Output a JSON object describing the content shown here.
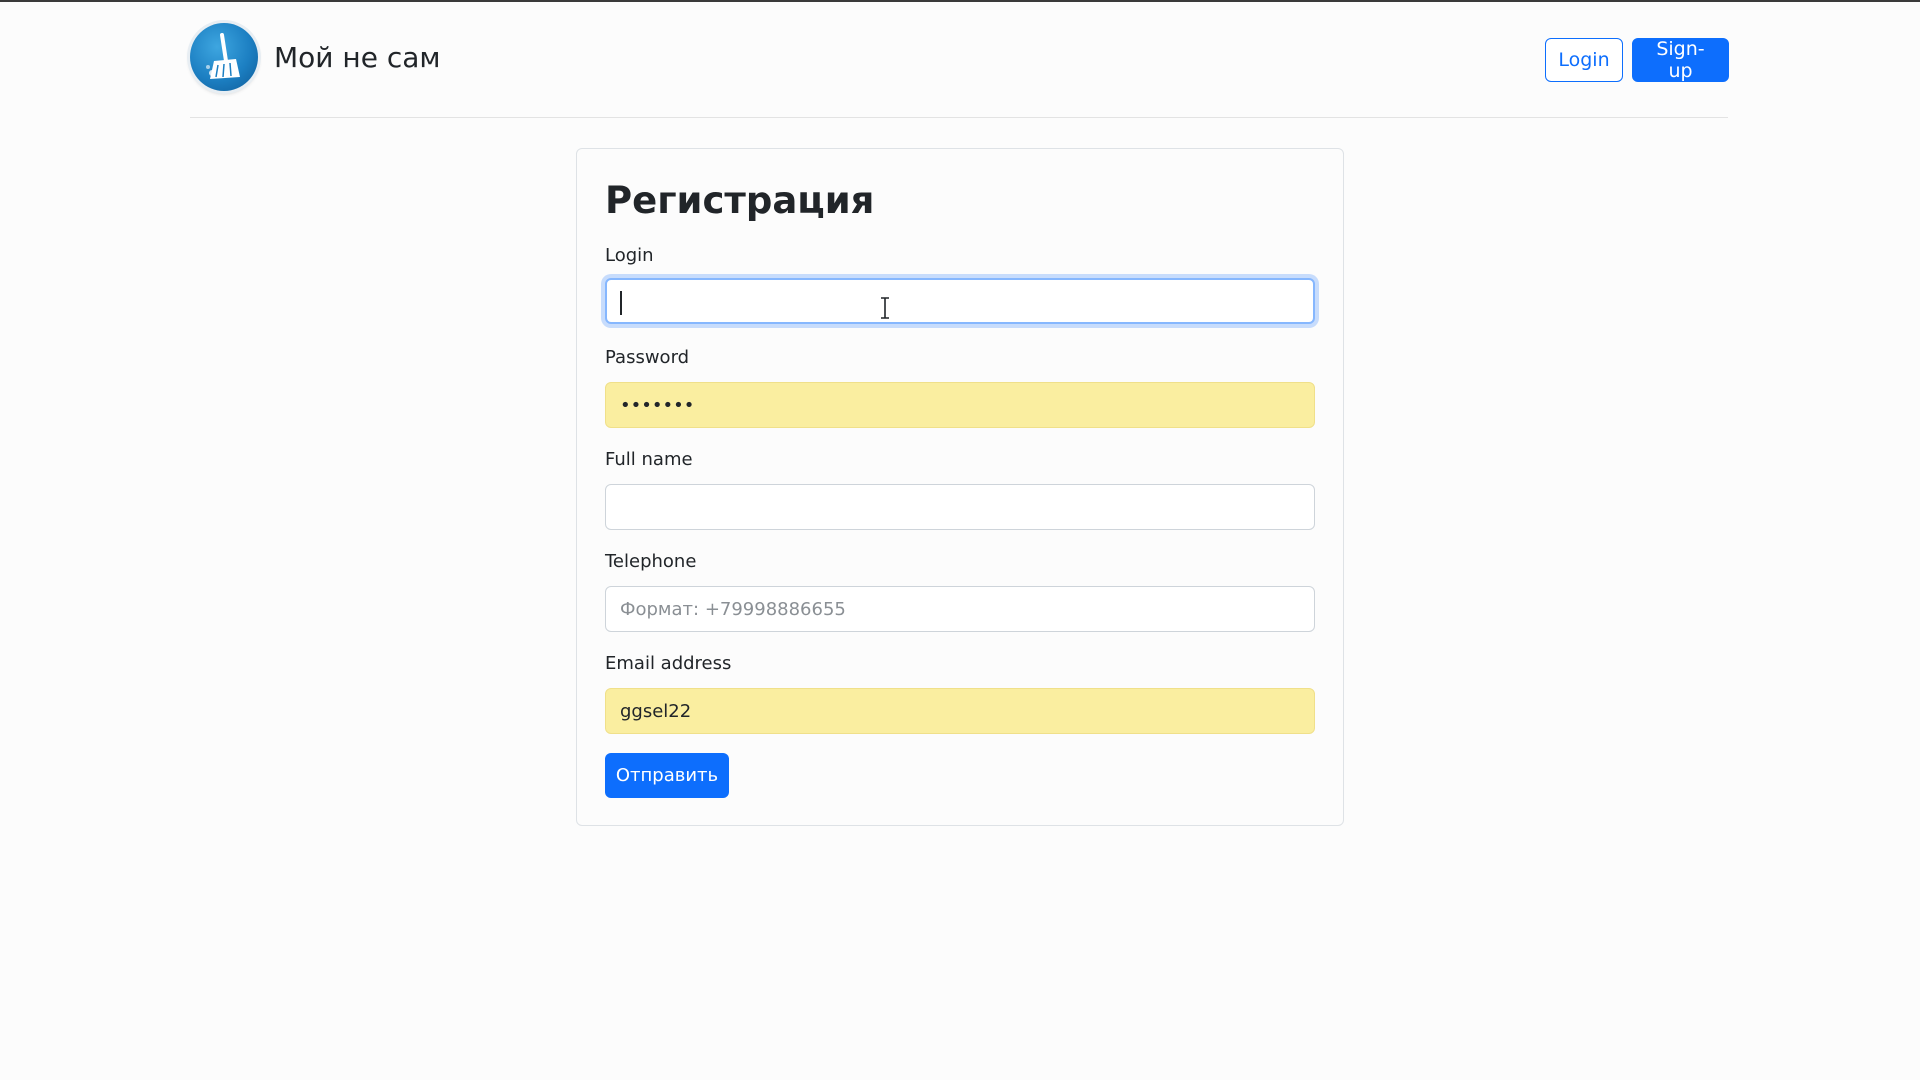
{
  "header": {
    "brand_name": "Мой не сам",
    "logo_icon": "broom-icon",
    "login_label": "Login",
    "signup_label": "Sign-up"
  },
  "form": {
    "title": "Регистрация",
    "login": {
      "label": "Login",
      "value": ""
    },
    "password": {
      "label": "Password",
      "value": "•••••••"
    },
    "full_name": {
      "label": "Full name",
      "value": ""
    },
    "telephone": {
      "label": "Telephone",
      "placeholder": "Формат: +79998886655",
      "value": ""
    },
    "email": {
      "label": "Email address",
      "value": "ggsel22"
    },
    "submit_label": "Отправить"
  },
  "colors": {
    "primary": "#0d6efd",
    "autofill": "#faeea0",
    "focus_ring": "#86b7fe"
  }
}
